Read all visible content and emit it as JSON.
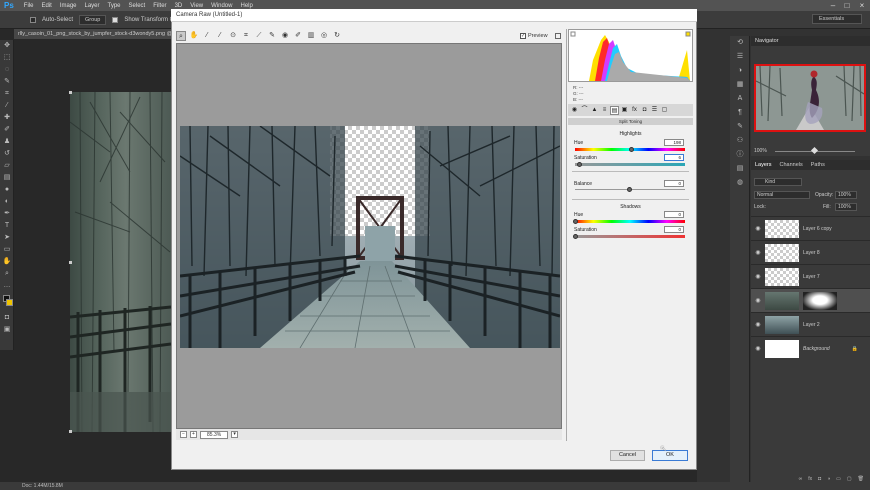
{
  "menubar": {
    "logo": "Ps",
    "items": [
      "File",
      "Edit",
      "Image",
      "Layer",
      "Type",
      "Select",
      "Filter",
      "3D",
      "View",
      "Window",
      "Help"
    ],
    "window_min": "–",
    "window_max": "□",
    "window_close": "×"
  },
  "optbar": {
    "auto_select": "Auto-Select",
    "group": "Group",
    "show_transform": "Show Transform Controls",
    "workspace": "Essentials"
  },
  "doc_tab": "rlly_casoin_01_png_stock_by_jumpfer_stock-d3wondy5.png @ 10",
  "status_bar": "Doc: 1.44M/15.8M",
  "dialog": {
    "title": "Camera Raw (Untitled-1)",
    "preview_label": "Preview",
    "zoom_value": "85.3%",
    "rgb_r": "R:  ---",
    "rgb_g": "G:  ---",
    "rgb_b": "B:  ---",
    "panel_title": "Split Toning",
    "highlights_header": "Highlights",
    "shadows_header": "Shadows",
    "sliders": {
      "hl_hue_label": "Hue",
      "hl_hue_value": "198",
      "hl_sat_label": "Saturation",
      "hl_sat_value": "6",
      "balance_label": "Balance",
      "balance_value": "0",
      "sh_hue_label": "Hue",
      "sh_hue_value": "0",
      "sh_sat_label": "Saturation",
      "sh_sat_value": "0"
    },
    "cancel_label": "Cancel",
    "ok_label": "OK"
  },
  "navigator": {
    "tab_label": "Navigator",
    "zoom": "100%"
  },
  "layers_panel": {
    "tabs": [
      "Layers",
      "Channels",
      "Paths"
    ],
    "kind": "Kind",
    "blend_mode": "Normal",
    "opacity_label": "Opacity:",
    "opacity_value": "100%",
    "lock_label": "Lock:",
    "fill_label": "Fill:",
    "fill_value": "100%",
    "layers": [
      {
        "name": "Layer 6 copy"
      },
      {
        "name": "Layer 8"
      },
      {
        "name": "Layer 7"
      },
      {
        "name": ""
      },
      {
        "name": "Layer 2"
      },
      {
        "name": "Background"
      }
    ]
  },
  "colors": {
    "accent": "#3a7bd5",
    "nav_frame": "#dd1111"
  }
}
